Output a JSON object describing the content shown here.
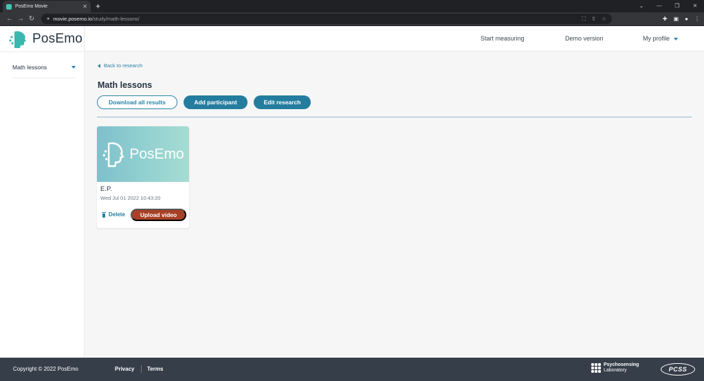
{
  "browser": {
    "tab_title": "PosEmo Movie",
    "tab_close": "✕",
    "new_tab": "+",
    "url_host": "movie.posemo.io",
    "url_path": "/study/math-lessons/"
  },
  "brand": {
    "name": "PosEmo",
    "accent": "#2a82a7",
    "button_fill": "#247d9f",
    "upload_color": "#a84126",
    "footer_bg": "#363e49"
  },
  "sidebar": {
    "items": [
      {
        "label": "Math lessons"
      }
    ]
  },
  "topnav": {
    "start_measuring": "Start measuring",
    "demo_version": "Demo version",
    "my_profile": "My profile"
  },
  "main": {
    "back_link": "Back to research",
    "title": "Math lessons",
    "buttons": {
      "download": "Download all results",
      "add_participant": "Add participant",
      "edit_research": "Edit research"
    },
    "participants": [
      {
        "image_text": "PosEmo",
        "name": "E.P.",
        "date": "Wed Jul 01 2022 10:43:20",
        "delete_label": "Delete",
        "upload_label": "Upload video"
      }
    ]
  },
  "footer": {
    "copyright": "Copyright © 2022 PosEmo",
    "privacy": "Privacy",
    "terms": "Terms",
    "lab_line1": "Psychosensing",
    "lab_line2": "Laboratory",
    "pcss": "PCSS"
  }
}
